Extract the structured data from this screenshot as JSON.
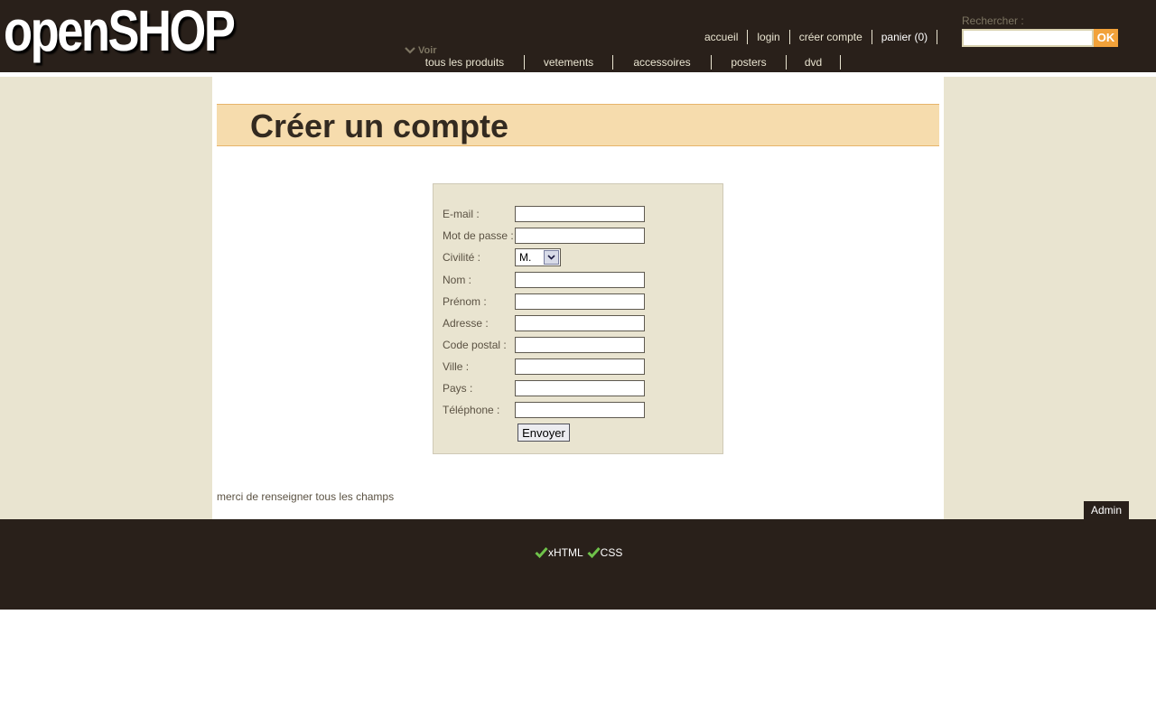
{
  "header": {
    "logo": "openSHOP",
    "top_links": [
      {
        "label": "accueil"
      },
      {
        "label": "login"
      },
      {
        "label": "créer compte"
      },
      {
        "label": "panier (0)"
      }
    ],
    "search": {
      "label": "Rechercher :",
      "button": "OK",
      "value": ""
    },
    "voir_label": "Voir",
    "categories": [
      {
        "label": "tous les produits"
      },
      {
        "label": "vetements"
      },
      {
        "label": "accessoires"
      },
      {
        "label": "posters"
      },
      {
        "label": "dvd"
      }
    ]
  },
  "main": {
    "title": "Créer un compte",
    "form": {
      "fields": [
        {
          "label": "E-mail :",
          "value": ""
        },
        {
          "label": "Mot de passe :",
          "value": ""
        },
        {
          "label": "Civilité :",
          "value": "M."
        },
        {
          "label": "Nom :",
          "value": ""
        },
        {
          "label": "Prénom :",
          "value": ""
        },
        {
          "label": "Adresse :",
          "value": ""
        },
        {
          "label": "Code postal :",
          "value": ""
        },
        {
          "label": "Ville :",
          "value": ""
        },
        {
          "label": "Pays :",
          "value": ""
        },
        {
          "label": "Téléphone :",
          "value": ""
        }
      ],
      "submit": "Envoyer"
    },
    "note": "merci de renseigner tous les champs"
  },
  "admin_label": "Admin",
  "footer": {
    "validators": [
      "xHTML",
      "CSS"
    ]
  },
  "colors": {
    "header_bg": "#29201a",
    "side_bg": "#e9e4d0",
    "title_bg": "#f6dcad",
    "accent": "#f2a23a"
  },
  "icons": [
    "chevron-down-icon",
    "checkmark-icon"
  ]
}
